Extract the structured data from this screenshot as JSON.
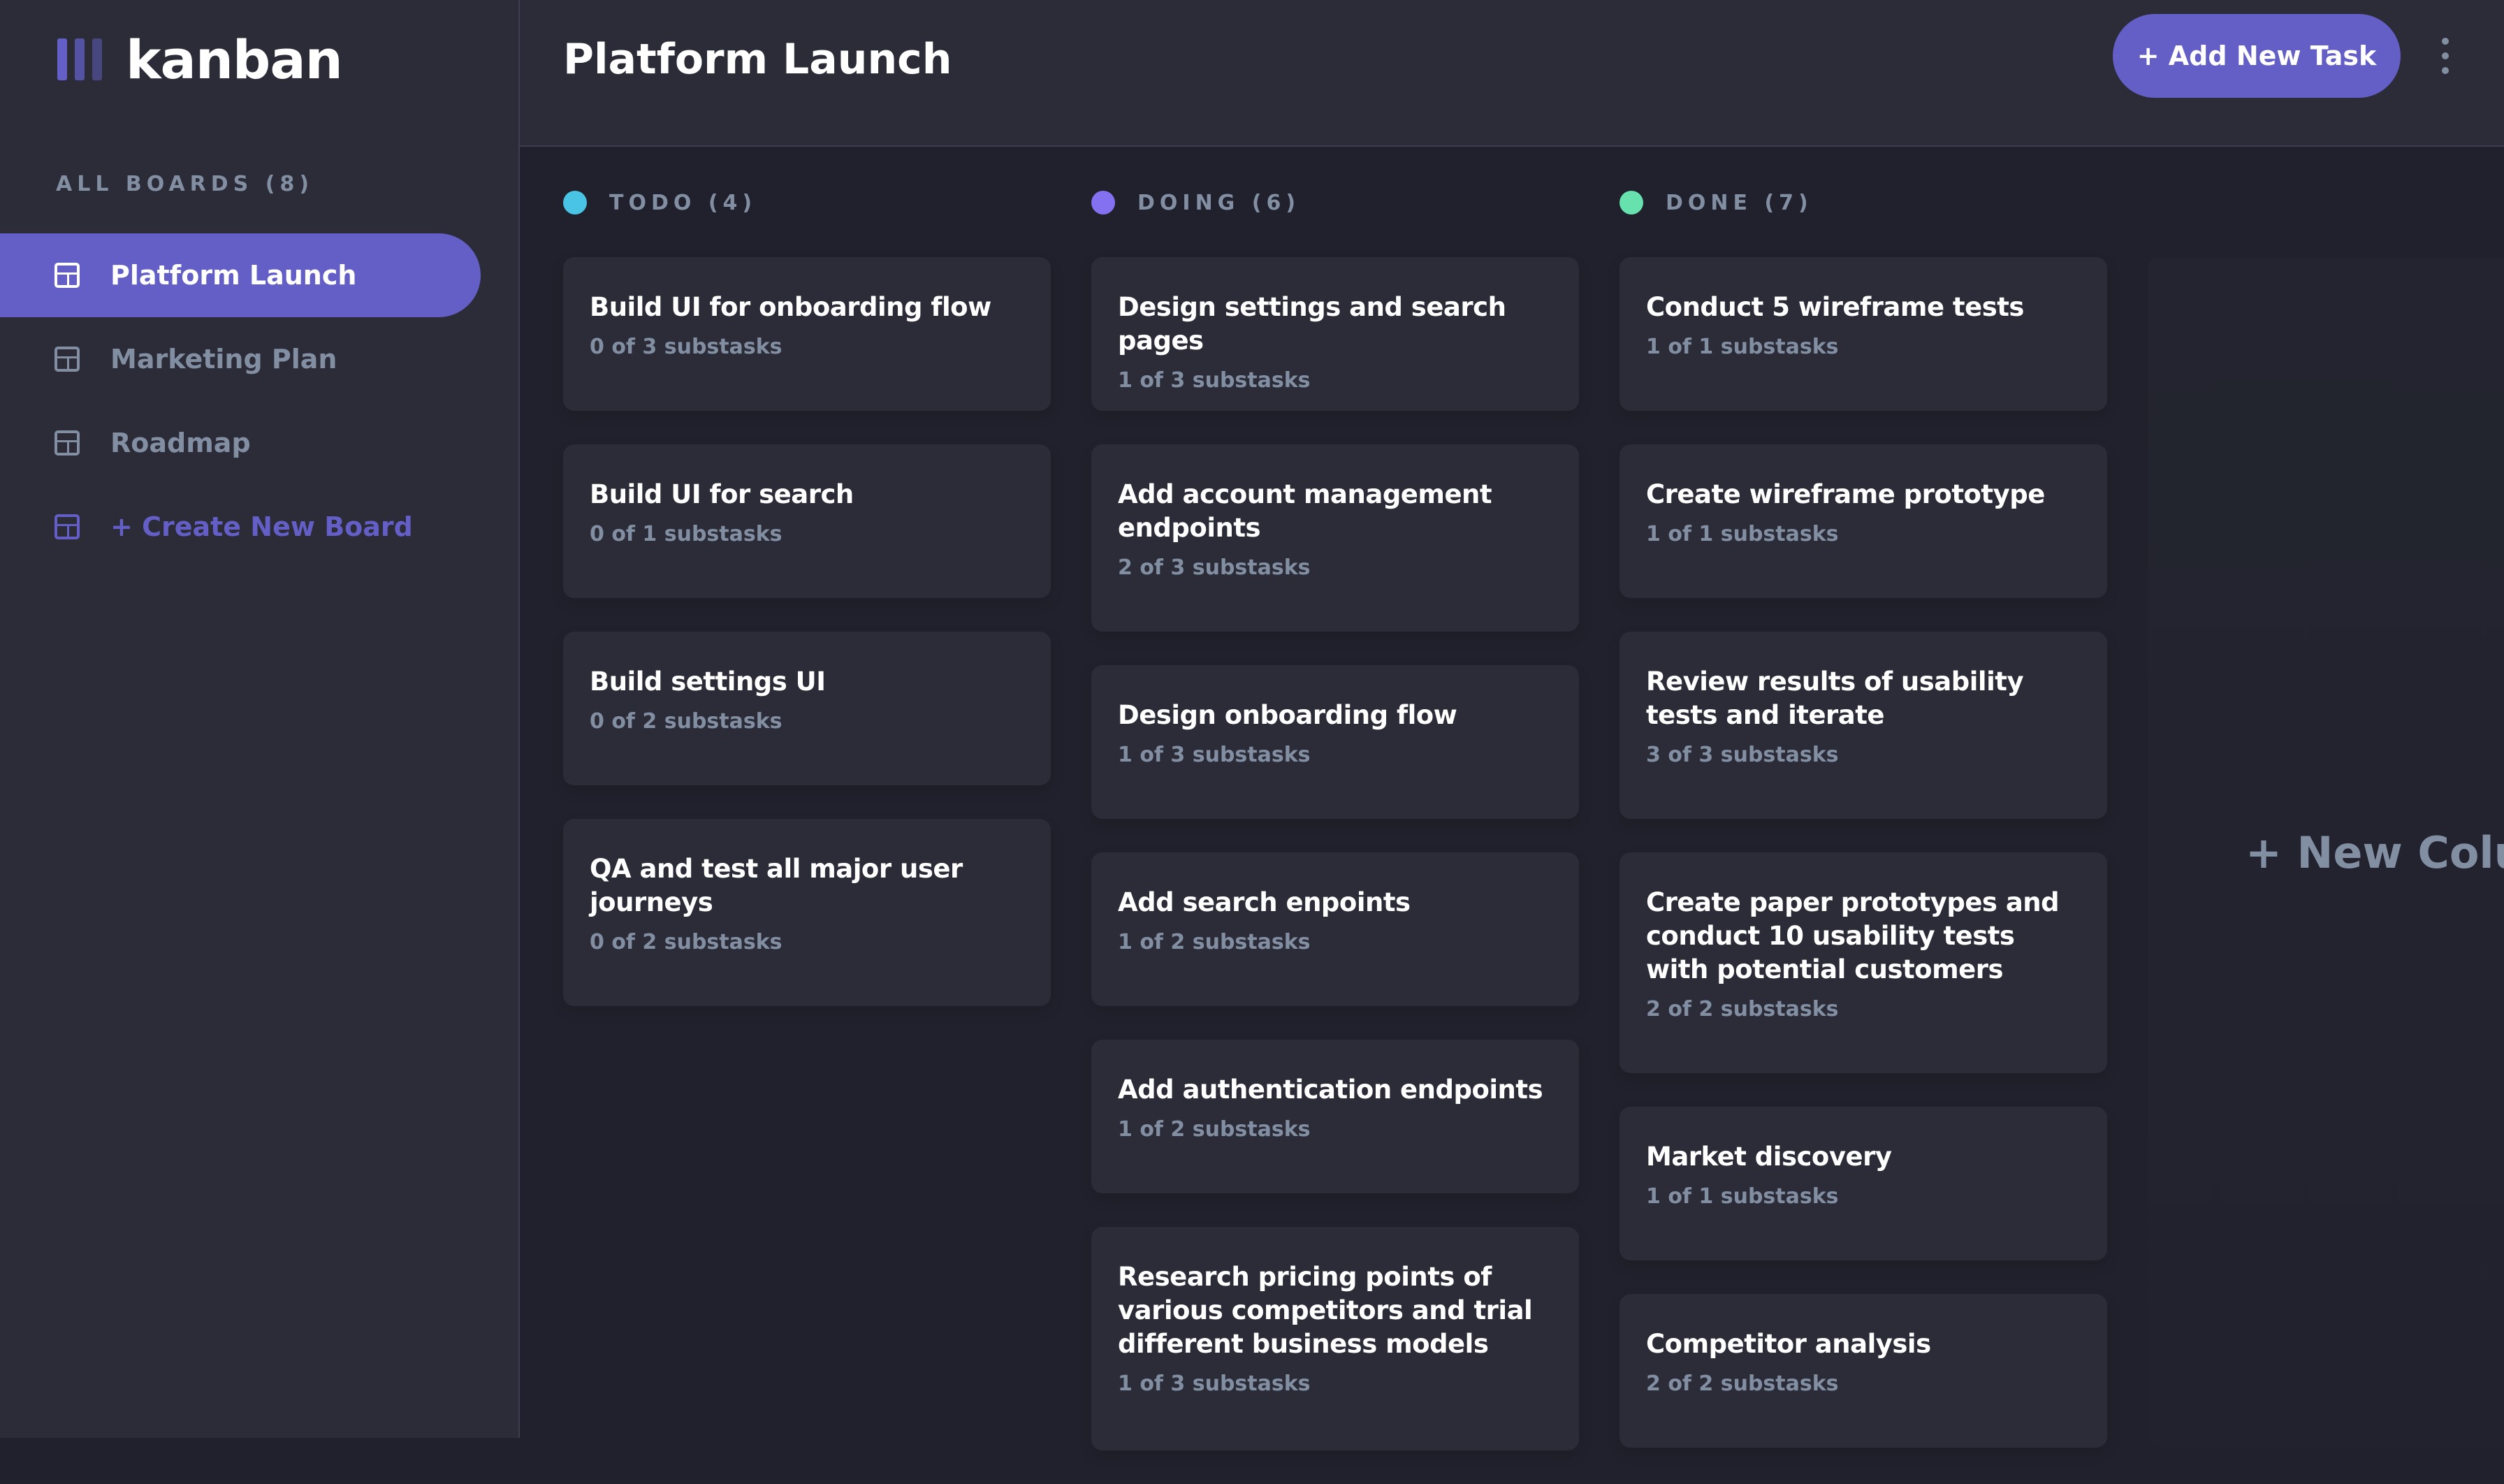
{
  "app": {
    "logo_text": "kanban"
  },
  "sidebar": {
    "heading": "ALL BOARDS (8)",
    "boards": [
      {
        "label": "Platform Launch",
        "active": true
      },
      {
        "label": "Marketing Plan",
        "active": false
      },
      {
        "label": "Roadmap",
        "active": false
      }
    ],
    "create_label": "+ Create New Board"
  },
  "header": {
    "title": "Platform Launch",
    "add_task_label": "+ Add New Task",
    "menu_icon": "vertical-ellipsis-icon"
  },
  "columns": [
    {
      "title": "TODO (4)",
      "color": "#49c4e5",
      "tasks": [
        {
          "title": "Build UI for onboarding flow",
          "subtasks": "0 of 3 substasks"
        },
        {
          "title": "Build UI for search",
          "subtasks": "0 of 1 substasks"
        },
        {
          "title": "Build settings UI",
          "subtasks": "0 of 2 substasks"
        },
        {
          "title": "QA and test all major user journeys",
          "subtasks": "0 of 2 substasks"
        }
      ]
    },
    {
      "title": "DOING (6)",
      "color": "#8471f2",
      "tasks": [
        {
          "title": "Design settings and search pages",
          "subtasks": "1 of 3 substasks"
        },
        {
          "title": "Add account management endpoints",
          "subtasks": "2 of 3 substasks"
        },
        {
          "title": "Design onboarding flow",
          "subtasks": "1 of 3 substasks"
        },
        {
          "title": "Add search enpoints",
          "subtasks": "1 of 2 substasks"
        },
        {
          "title": "Add authentication endpoints",
          "subtasks": "1 of 2 substasks"
        },
        {
          "title": "Research pricing points of various competitors and trial different business models",
          "subtasks": "1 of 3 substasks"
        }
      ]
    },
    {
      "title": "DONE (7)",
      "color": "#67e2ae",
      "tasks": [
        {
          "title": "Conduct 5 wireframe tests",
          "subtasks": "1 of 1 substasks"
        },
        {
          "title": "Create wireframe prototype",
          "subtasks": "1 of 1 substasks"
        },
        {
          "title": "Review results of usability tests and iterate",
          "subtasks": "3 of 3 substasks"
        },
        {
          "title": "Create paper prototypes and conduct 10 usability tests with potential customers",
          "subtasks": "2 of 2 substasks"
        },
        {
          "title": "Market discovery",
          "subtasks": "1 of 1 substasks"
        },
        {
          "title": "Competitor analysis",
          "subtasks": "2 of 2 substasks"
        }
      ]
    }
  ],
  "new_column_label": "+ New Column",
  "theme": {
    "accent": "#635fc7",
    "background": "#20212c",
    "panel": "#2b2c37",
    "muted_text": "#828fa3"
  }
}
